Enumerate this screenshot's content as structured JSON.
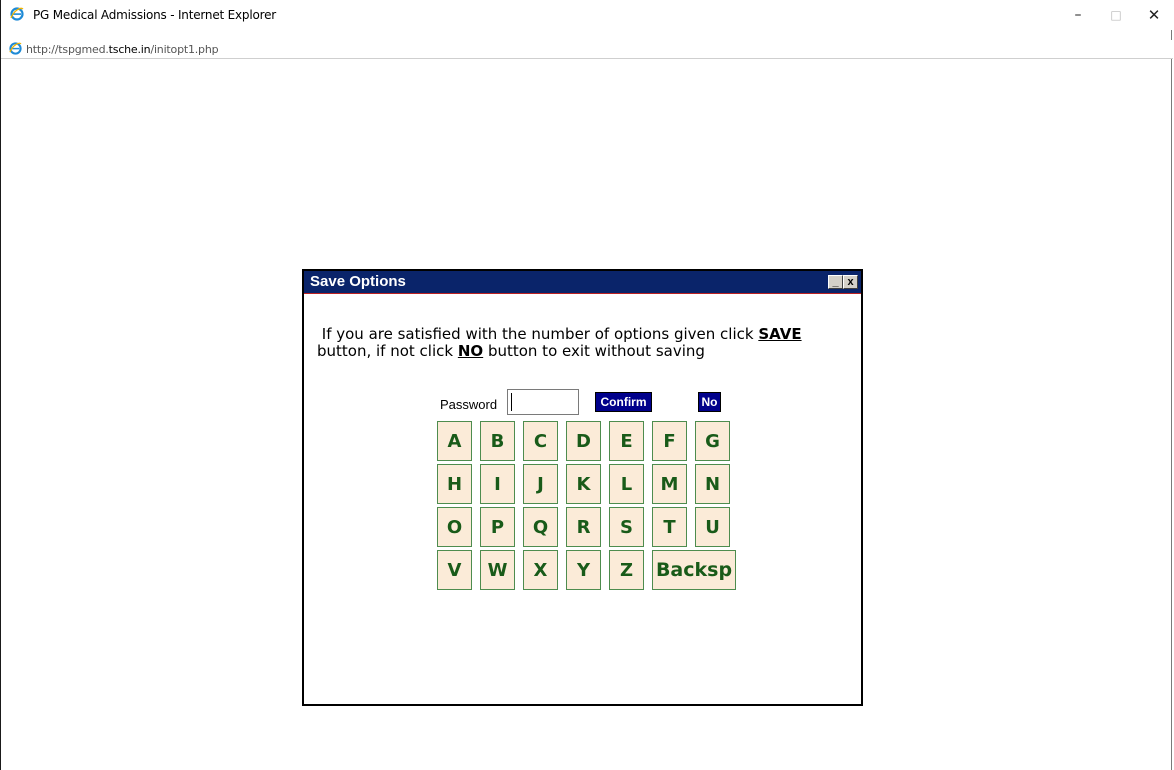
{
  "window": {
    "title": "PG Medical Admissions - Internet Explorer",
    "minimize": "–",
    "maximize": "□",
    "close": "✕"
  },
  "address": {
    "prefix": "http://tspgmed.",
    "domain": "tsche.in",
    "path": "/initopt1.php"
  },
  "dialog": {
    "title": "Save Options",
    "min_label": "_",
    "close_label": "x",
    "message": {
      "part1": "If you are satisfied with the number of options given click ",
      "save": "SAVE",
      "part2": "button, if not click ",
      "no": "NO",
      "part3": " button to exit without saving"
    },
    "password_label": "Password",
    "password_value": "",
    "confirm_label": "Confirm",
    "no_label": "No"
  },
  "keyboard": {
    "rows": [
      [
        "A",
        "B",
        "C",
        "D",
        "E",
        "F",
        "G"
      ],
      [
        "H",
        "I",
        "J",
        "K",
        "L",
        "M",
        "N"
      ],
      [
        "O",
        "P",
        "Q",
        "R",
        "S",
        "T",
        "U"
      ],
      [
        "V",
        "W",
        "X",
        "Y",
        "Z",
        "Backsp"
      ]
    ]
  },
  "colors": {
    "dialog_titlebar": "#0a246a",
    "button_blue": "#00008b",
    "key_bg": "#fbebd8",
    "key_text": "#195b19"
  }
}
